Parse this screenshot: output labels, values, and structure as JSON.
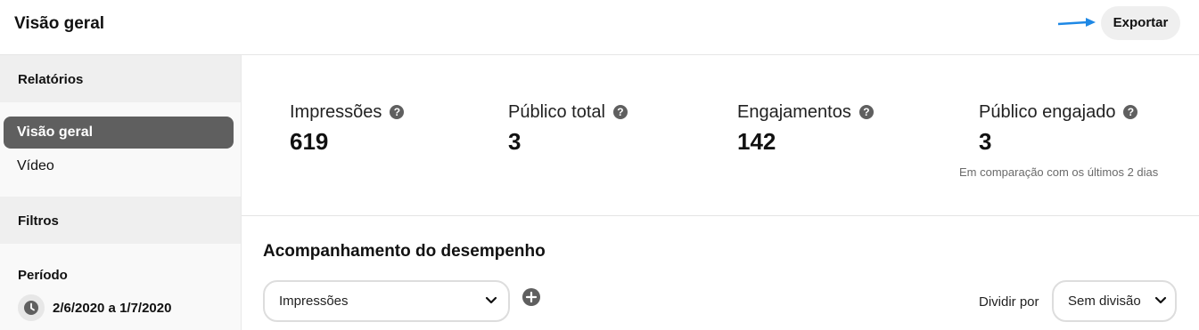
{
  "header": {
    "title": "Visão geral",
    "export_label": "Exportar"
  },
  "sidebar": {
    "reports_label": "Relatórios",
    "nav_items": [
      {
        "label": "Visão geral",
        "active": true
      },
      {
        "label": "Vídeo",
        "active": false
      }
    ],
    "filters_label": "Filtros",
    "period_label": "Período",
    "date_range": "2/6/2020 a 1/7/2020"
  },
  "metrics": [
    {
      "label": "Impressões",
      "value": "619"
    },
    {
      "label": "Público total",
      "value": "3"
    },
    {
      "label": "Engajamentos",
      "value": "142"
    },
    {
      "label": "Público engajado",
      "value": "3"
    }
  ],
  "comparison_note": "Em comparação com os últimos 2 dias",
  "performance": {
    "title": "Acompanhamento do desempenho",
    "metric_select_value": "Impressões",
    "divide_label": "Dividir por",
    "divide_select_value": "Sem divisão"
  },
  "colors": {
    "active_nav": "#5f5f5f",
    "arrow": "#1e88e5",
    "button_bg": "#efefef"
  },
  "icons": {
    "help": "question-circle-icon",
    "clock": "clock-icon",
    "add": "plus-circle-icon",
    "chevron": "chevron-down-icon",
    "arrow": "arrow-right-icon"
  }
}
